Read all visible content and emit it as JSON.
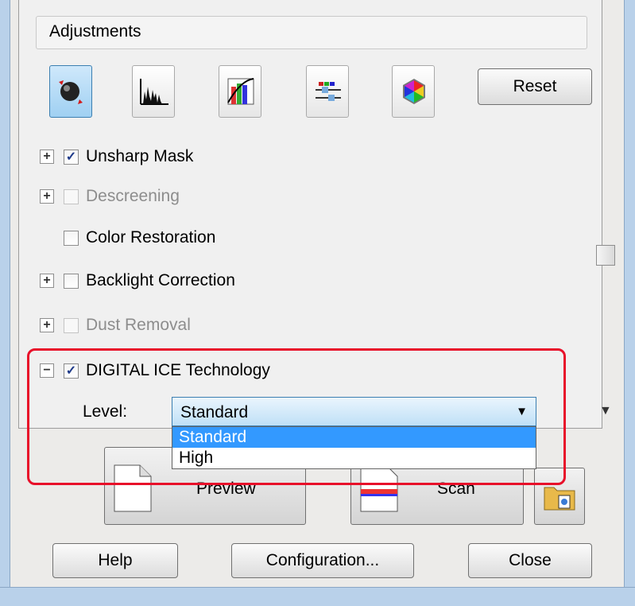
{
  "panel": {
    "title": "Adjustments",
    "toolbar": [
      "auto-exposure-icon",
      "histogram-icon",
      "tone-curve-icon",
      "color-palette-icon",
      "color-wheel-icon"
    ],
    "reset_label": "Reset"
  },
  "options": [
    {
      "label": "Unsharp Mask",
      "checked": true,
      "enabled": true,
      "expander": "+"
    },
    {
      "label": "Descreening",
      "checked": false,
      "enabled": false,
      "expander": "+"
    },
    {
      "label": "Color Restoration",
      "checked": false,
      "enabled": true,
      "expander": ""
    },
    {
      "label": "Backlight Correction",
      "checked": false,
      "enabled": true,
      "expander": "+"
    },
    {
      "label": "Dust Removal",
      "checked": false,
      "enabled": false,
      "expander": "+"
    },
    {
      "label": "DIGITAL ICE Technology",
      "checked": true,
      "enabled": true,
      "expander": "−"
    }
  ],
  "level": {
    "label": "Level:",
    "selected": "Standard",
    "options": [
      "Standard",
      "High"
    ]
  },
  "actions": {
    "preview_label": "Preview",
    "scan_label": "Scan"
  },
  "footer": {
    "help_label": "Help",
    "config_label": "Configuration...",
    "close_label": "Close"
  },
  "colors": {
    "highlight": "#e8102a",
    "selection": "#3399ff"
  }
}
